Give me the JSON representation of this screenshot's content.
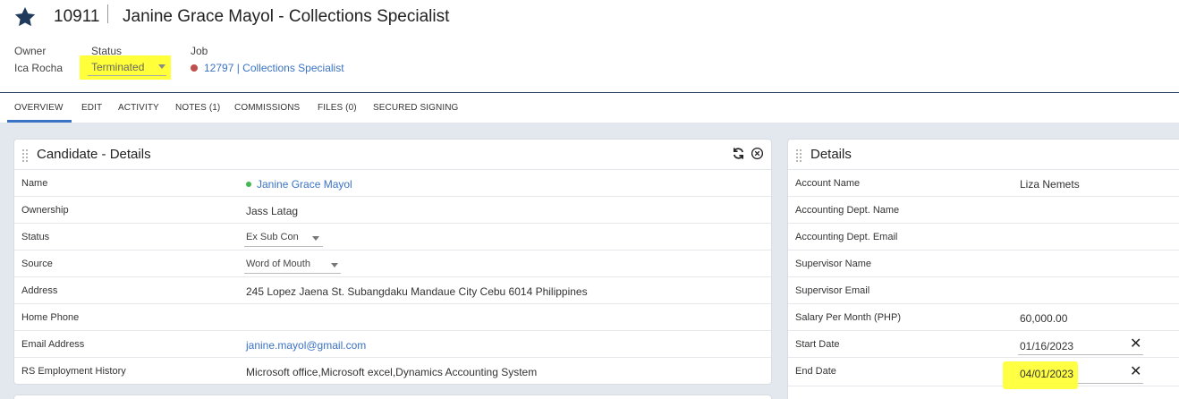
{
  "record": {
    "id": "10911",
    "title": "Janine Grace Mayol - Collections Specialist"
  },
  "meta": {
    "owner_label": "Owner",
    "owner_value": "Ica Rocha",
    "status_label": "Status",
    "status_value": "Terminated",
    "job_label": "Job",
    "job_link": "12797 | Collections Specialist"
  },
  "tabs": [
    {
      "label": "OVERVIEW",
      "active": true
    },
    {
      "label": "EDIT"
    },
    {
      "label": "ACTIVITY"
    },
    {
      "label": "NOTES (1)"
    },
    {
      "label": "COMMISSIONS"
    },
    {
      "label": "FILES (0)"
    },
    {
      "label": "SECURED SIGNING"
    }
  ],
  "candidate_panel": {
    "title": "Candidate - Details",
    "rows": [
      {
        "label": "Name",
        "value": "Janine Grace Mayol"
      },
      {
        "label": "Ownership",
        "value": "Jass Latag"
      },
      {
        "label": "Status",
        "value": "Ex Sub Con"
      },
      {
        "label": "Source",
        "value": "Word of Mouth"
      },
      {
        "label": "Address",
        "value": "245 Lopez Jaena St. Subangdaku Mandaue City Cebu 6014 Philippines"
      },
      {
        "label": "Home Phone",
        "value": ""
      },
      {
        "label": "Email Address",
        "value": "janine.mayol@gmail.com"
      },
      {
        "label": "RS Employment History",
        "value": "Microsoft office,Microsoft excel,Dynamics Accounting System"
      }
    ]
  },
  "details_panel": {
    "title": "Details",
    "rows": [
      {
        "label": "Account Name",
        "value": "Liza Nemets"
      },
      {
        "label": "Accounting Dept. Name",
        "value": ""
      },
      {
        "label": "Accounting Dept. Email",
        "value": ""
      },
      {
        "label": "Supervisor Name",
        "value": ""
      },
      {
        "label": "Supervisor Email",
        "value": ""
      },
      {
        "label": "Salary Per Month (PHP)",
        "value": "60,000.00"
      },
      {
        "label": "Start Date",
        "value": "01/16/2023"
      },
      {
        "label": "End Date",
        "value": "04/01/2023"
      }
    ]
  },
  "colors": {
    "accent": "#3b73c4",
    "highlight": "#ffff3a",
    "star": "#1f3a5a"
  }
}
